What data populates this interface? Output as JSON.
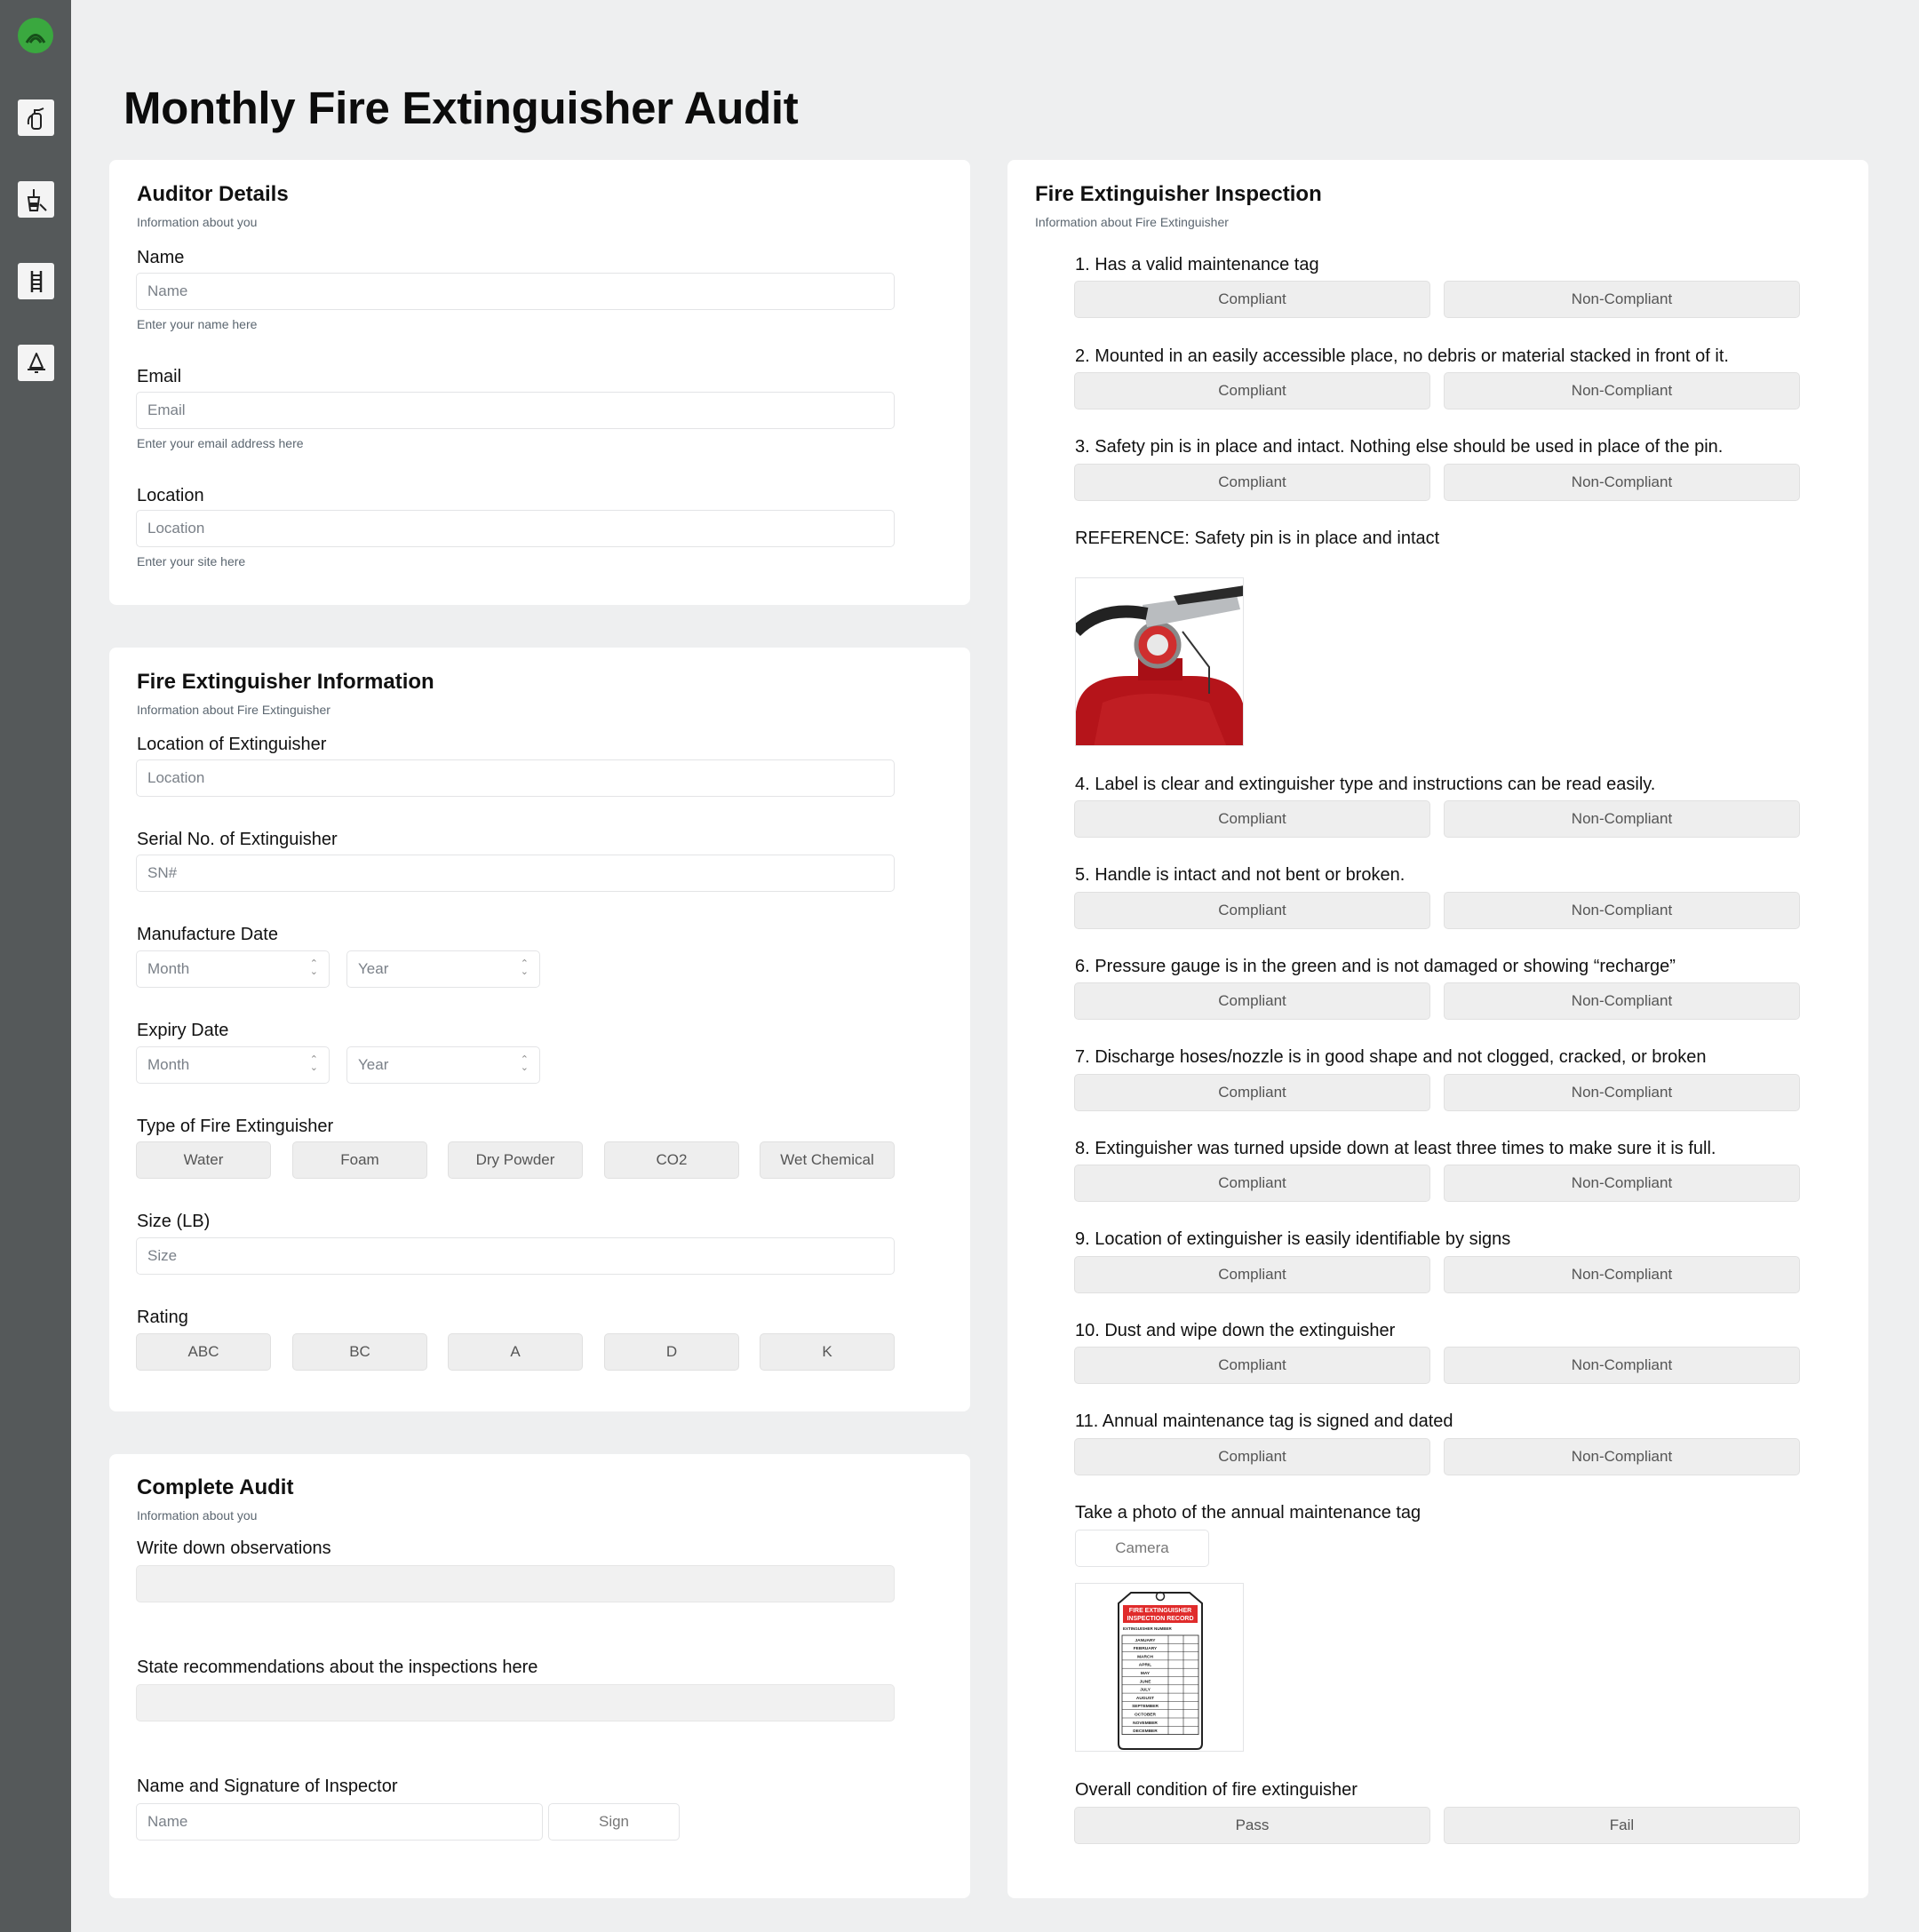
{
  "page": {
    "title": "Monthly Fire Extinguisher Audit"
  },
  "sidebar": {
    "logo": "app-logo-icon",
    "items": [
      {
        "icon": "fire-extinguisher-icon"
      },
      {
        "icon": "cleaning-bucket-icon"
      },
      {
        "icon": "ladder-icon"
      },
      {
        "icon": "bell-icon"
      }
    ]
  },
  "auditor": {
    "title": "Auditor Details",
    "subtitle": "Information about you",
    "name_label": "Name",
    "name_placeholder": "Name",
    "name_hint": "Enter your name here",
    "email_label": "Email",
    "email_placeholder": "Email",
    "email_hint": "Enter your email address here",
    "location_label": "Location",
    "location_placeholder": "Location",
    "location_hint": "Enter your site here"
  },
  "extinguisher_info": {
    "title": "Fire Extinguisher Information",
    "subtitle": "Information about Fire Extinguisher",
    "location_label": "Location of Extinguisher",
    "location_placeholder": "Location",
    "serial_label": "Serial No. of Extinguisher",
    "serial_placeholder": "SN#",
    "manufacture_label": "Manufacture Date",
    "expiry_label": "Expiry Date",
    "month_placeholder": "Month",
    "year_placeholder": "Year",
    "type_label": "Type of Fire Extinguisher",
    "types": [
      "Water",
      "Foam",
      "Dry Powder",
      "CO2",
      "Wet Chemical"
    ],
    "size_label": "Size (LB)",
    "size_placeholder": "Size",
    "rating_label": "Rating",
    "ratings": [
      "ABC",
      "BC",
      "A",
      "D",
      "K"
    ]
  },
  "complete": {
    "title": "Complete Audit",
    "subtitle": "Information about you",
    "observations_label": "Write down observations",
    "recommendations_label": "State recommendations about the inspections here",
    "signature_label": "Name and Signature of Inspector",
    "name_placeholder": "Name",
    "sign_label": "Sign"
  },
  "inspection": {
    "title": "Fire Extinguisher Inspection",
    "subtitle": "Information about Fire Extinguisher",
    "compliant": "Compliant",
    "non_compliant": "Non-Compliant",
    "questions": [
      " 1. Has a valid maintenance tag",
      " 2. Mounted in an easily accessible place, no debris or material stacked in front of it.",
      "3. Safety pin is in place and intact. Nothing else should be used in place of the pin.",
      "4. Label is clear and extinguisher type and instructions can be read easily.",
      " 5. Handle is intact and not bent or broken.",
      "6. Pressure gauge is in the green and is not damaged or showing “recharge”",
      "7. Discharge hoses/nozzle is in good shape and not clogged, cracked, or broken",
      "8. Extinguisher was turned upside down at least three times to make sure it is full.",
      "9. Location of extinguisher is easily identifiable by signs",
      "10. Dust and wipe down the extinguisher",
      "11. Annual maintenance tag is signed and dated"
    ],
    "reference_label": "REFERENCE: Safety pin is in place and intact",
    "photo_label": "Take a photo of the annual maintenance tag",
    "camera_label": "Camera",
    "tag": {
      "heading": "FIRE EXTINGUISHER INSPECTION RECORD",
      "number_label": "EXTINGUISHER NUMBER",
      "months": [
        "JANUARY",
        "FEBRUARY",
        "MARCH",
        "APRIL",
        "MAY",
        "JUNE",
        "JULY",
        "AUGUST",
        "SEPTEMBER",
        "OCTOBER",
        "NOVEMBER",
        "DECEMBER"
      ]
    },
    "overall_label": "Overall condition of fire extinguisher",
    "pass_label": "Pass",
    "fail_label": "Fail"
  },
  "colors": {
    "sidebar": "#55595a",
    "brand_green": "#3aa83f",
    "background": "#eeeff0",
    "tag_red": "#e02b2b"
  }
}
